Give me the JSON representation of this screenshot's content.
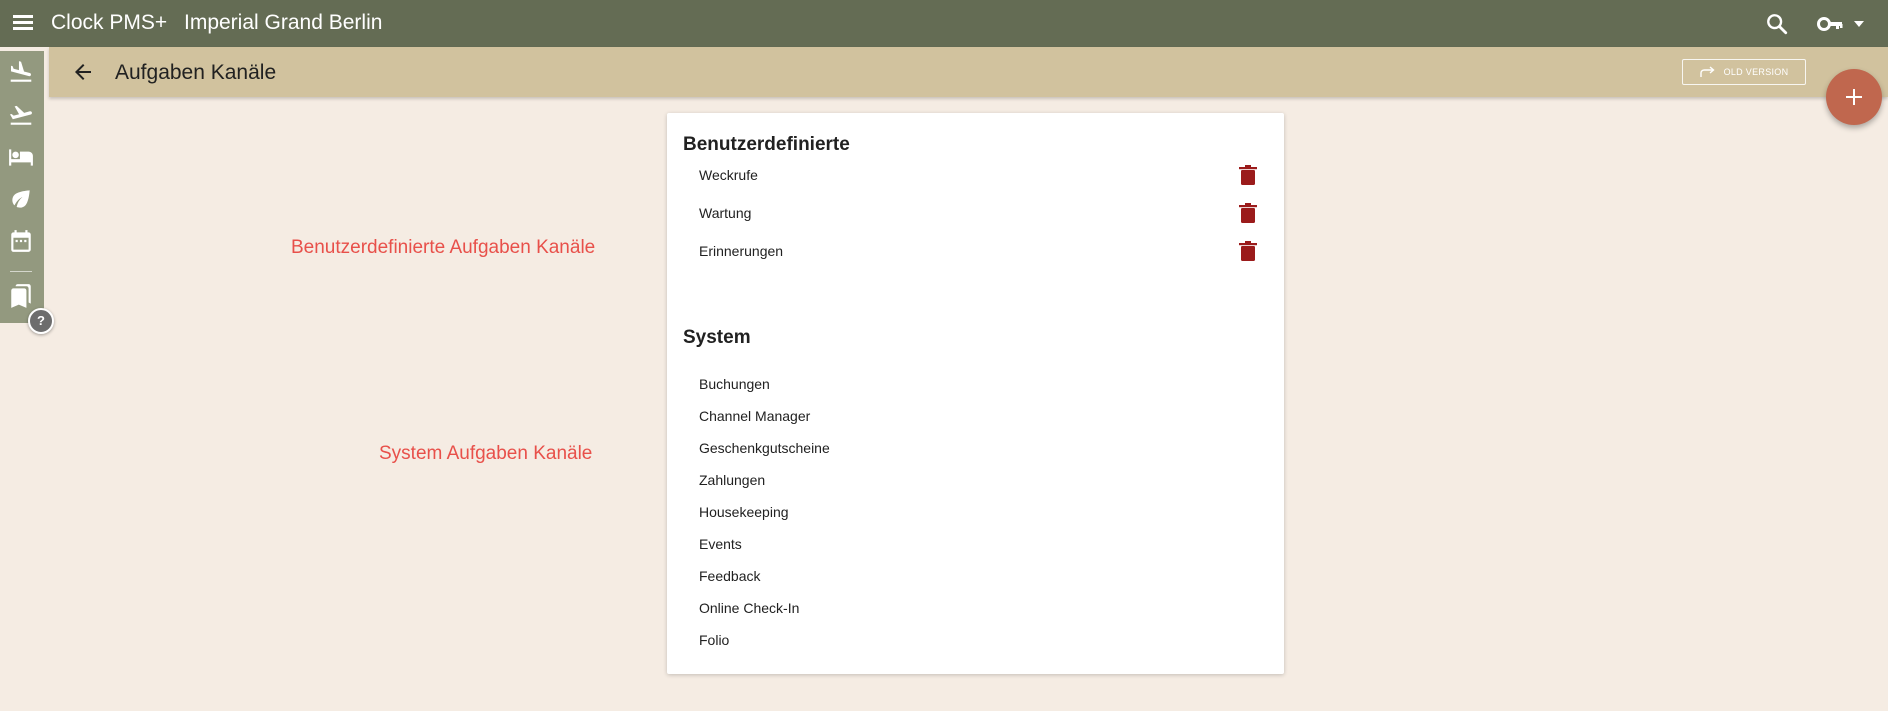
{
  "app": {
    "title": "Clock PMS+",
    "hotel": "Imperial Grand Berlin",
    "topbar_color": "#646c54",
    "icons": [
      "menu-icon",
      "search-icon",
      "key-icon",
      "arrow-drop-down-icon"
    ]
  },
  "sidebar": {
    "items": [
      {
        "name": "arrivals",
        "icon": "flight-land-icon"
      },
      {
        "name": "departures",
        "icon": "flight-takeoff-icon"
      },
      {
        "name": "rooms",
        "icon": "hotel-bed-icon"
      },
      {
        "name": "housekeeping",
        "icon": "leaf-icon"
      },
      {
        "name": "calendar",
        "icon": "calendar-icon"
      },
      {
        "name": "bookmarks",
        "icon": "bookmarks-icon"
      }
    ],
    "help_label": "?"
  },
  "subheader": {
    "title": "Aufgaben Kanäle",
    "old_version_label": "Old version",
    "fab_icon": "plus-icon",
    "accent": "#c0674e"
  },
  "annotations": {
    "custom": "Benutzerdefinierte Aufgaben Kanäle",
    "system": "System Aufgaben Kanäle",
    "color": "#e8504a"
  },
  "card": {
    "custom_title": "Benutzerdefinierte",
    "custom_channels": [
      "Weckrufe",
      "Wartung",
      "Erinnerungen"
    ],
    "system_title": "System",
    "system_channels": [
      "Buchungen",
      "Channel Manager",
      "Geschenkgutscheine",
      "Zahlungen",
      "Housekeeping",
      "Events",
      "Feedback",
      "Online Check-In",
      "Folio"
    ],
    "delete_color": "#9b1b1b"
  }
}
